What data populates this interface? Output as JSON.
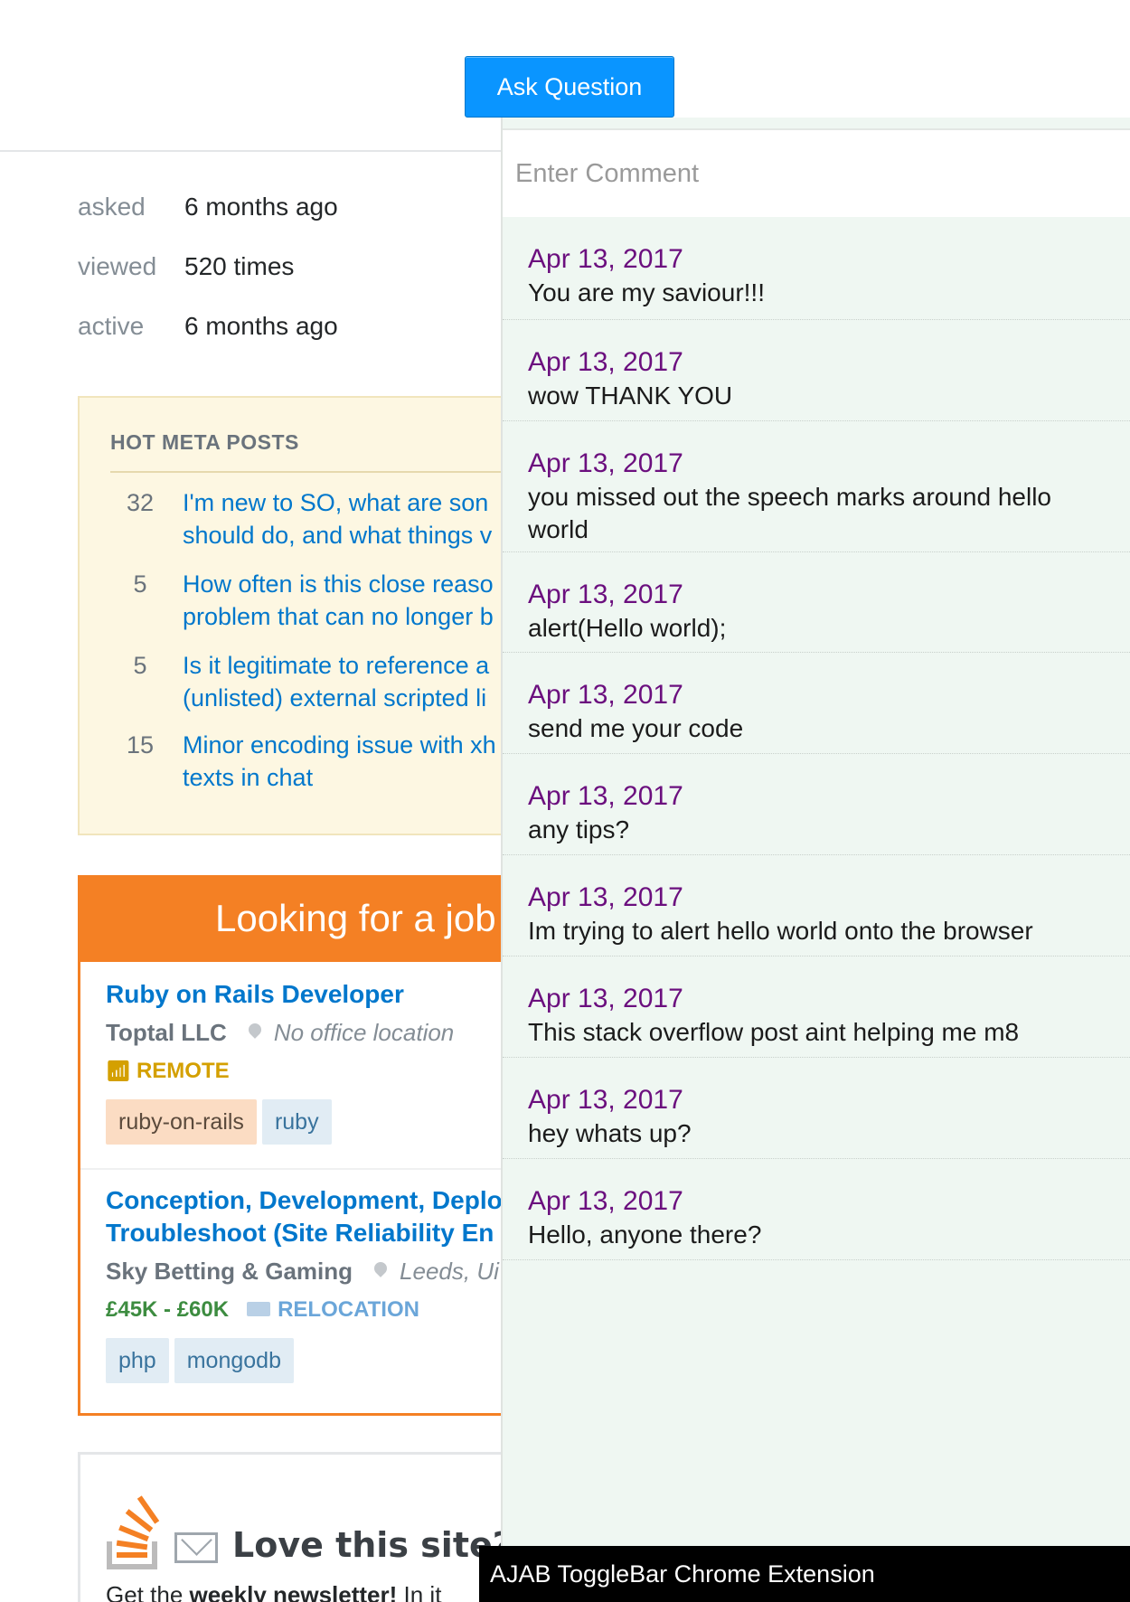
{
  "header": {
    "ask_button": "Ask Question"
  },
  "stats": [
    {
      "label": "asked",
      "value": "6 months ago"
    },
    {
      "label": "viewed",
      "value": "520 times"
    },
    {
      "label": "active",
      "value": "6 months ago"
    }
  ],
  "meta": {
    "title": "HOT META POSTS",
    "items": [
      {
        "count": "32",
        "line1": "I'm new to SO, what are son",
        "line2": "should do, and what things v"
      },
      {
        "count": "5",
        "line1": "How often is this close reaso",
        "line2": "problem that can no longer b"
      },
      {
        "count": "5",
        "line1": "Is it legitimate to reference a",
        "line2": "(unlisted) external scripted li"
      },
      {
        "count": "15",
        "line1": "Minor encoding issue with xh",
        "line2": "texts in chat"
      }
    ]
  },
  "jobs": {
    "header": "Looking for a job",
    "listings": [
      {
        "title_line1": "Ruby on Rails Developer",
        "title_line2": "",
        "company": "Toptal LLC",
        "location": "No office location",
        "perk1": "REMOTE",
        "perk2": "",
        "tags": [
          "ruby-on-rails",
          "ruby"
        ]
      },
      {
        "title_line1": "Conception, Development, Deplo",
        "title_line2": "Troubleshoot (Site Reliability En",
        "company": "Sky Betting & Gaming",
        "location": "Leeds, Ui",
        "perk1": "£45K - £60K",
        "perk2": "RELOCATION",
        "tags": [
          "php",
          "mongodb"
        ]
      }
    ]
  },
  "newsletter": {
    "title": "Love this site?",
    "text_prefix": "Get the ",
    "text_bold": "weekly newsletter!",
    "text_suffix": " In it"
  },
  "panel": {
    "placeholder": "Enter Comment",
    "comments": [
      {
        "date": "Apr 13, 2017",
        "text": "You are my saviour!!!"
      },
      {
        "date": "Apr 13, 2017",
        "text": "wow THANK YOU"
      },
      {
        "date": "Apr 13, 2017",
        "text": "you missed out the speech marks around hello world"
      },
      {
        "date": "Apr 13, 2017",
        "text": "alert(Hello world);"
      },
      {
        "date": "Apr 13, 2017",
        "text": "send me your code"
      },
      {
        "date": "Apr 13, 2017",
        "text": "any tips?"
      },
      {
        "date": "Apr 13, 2017",
        "text": "Im trying to alert hello world onto the browser"
      },
      {
        "date": "Apr 13, 2017",
        "text": "This stack overflow post aint helping me m8"
      },
      {
        "date": "Apr 13, 2017",
        "text": "hey whats up?"
      },
      {
        "date": "Apr 13, 2017",
        "text": "Hello, anyone there?"
      }
    ]
  },
  "extension": {
    "label": "AJAB ToggleBar Chrome Extension"
  },
  "colors": {
    "accent": "#0a95ff",
    "jobs": "#f48024",
    "comment_date": "#6b0f7e",
    "panel_bg": "#eff7f2"
  },
  "icons": [
    "location-pin-icon",
    "wifi-icon",
    "truck-icon",
    "stackoverflow-logo-icon",
    "mail-icon"
  ]
}
